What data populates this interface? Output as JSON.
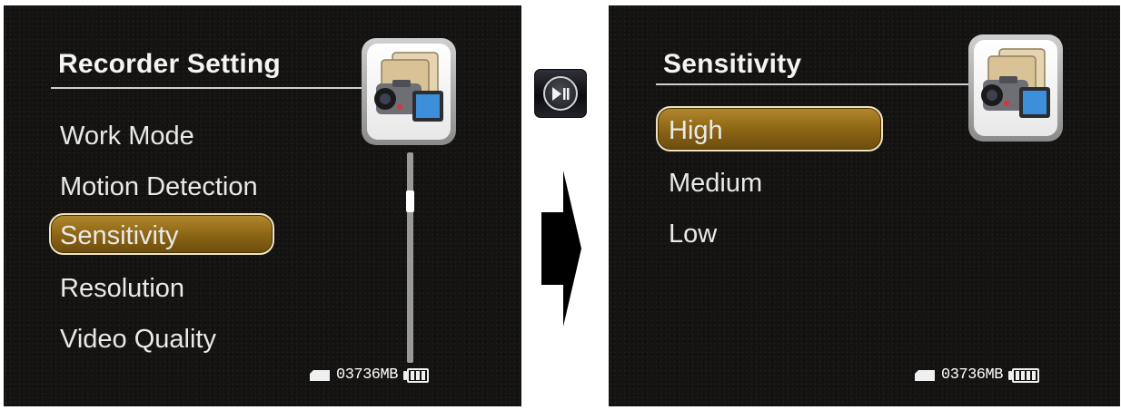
{
  "left_screen": {
    "title": "Recorder Setting",
    "menu": [
      {
        "label": "Work Mode",
        "selected": false
      },
      {
        "label": "Motion Detection",
        "selected": false
      },
      {
        "label": "Sensitivity",
        "selected": true
      },
      {
        "label": "Resolution",
        "selected": false
      },
      {
        "label": "Video Quality",
        "selected": false
      }
    ],
    "storage": "03736MB",
    "battery_icon": "battery-icon",
    "sd_card_icon": "sd-card-icon"
  },
  "right_screen": {
    "title": "Sensitivity",
    "options": [
      {
        "label": "High",
        "selected": true
      },
      {
        "label": "Medium",
        "selected": false
      },
      {
        "label": "Low",
        "selected": false
      }
    ],
    "storage": "03736MB",
    "battery_icon": "battery-icon",
    "sd_card_icon": "sd-card-icon"
  },
  "transition": {
    "button_icon": "play-pause-icon",
    "arrow_icon": "right-arrow-icon"
  },
  "colors": {
    "screen_background": "#141311",
    "highlight": "#8a6414",
    "highlight_border": "#efe3c0",
    "text": "#e9e9e9"
  }
}
